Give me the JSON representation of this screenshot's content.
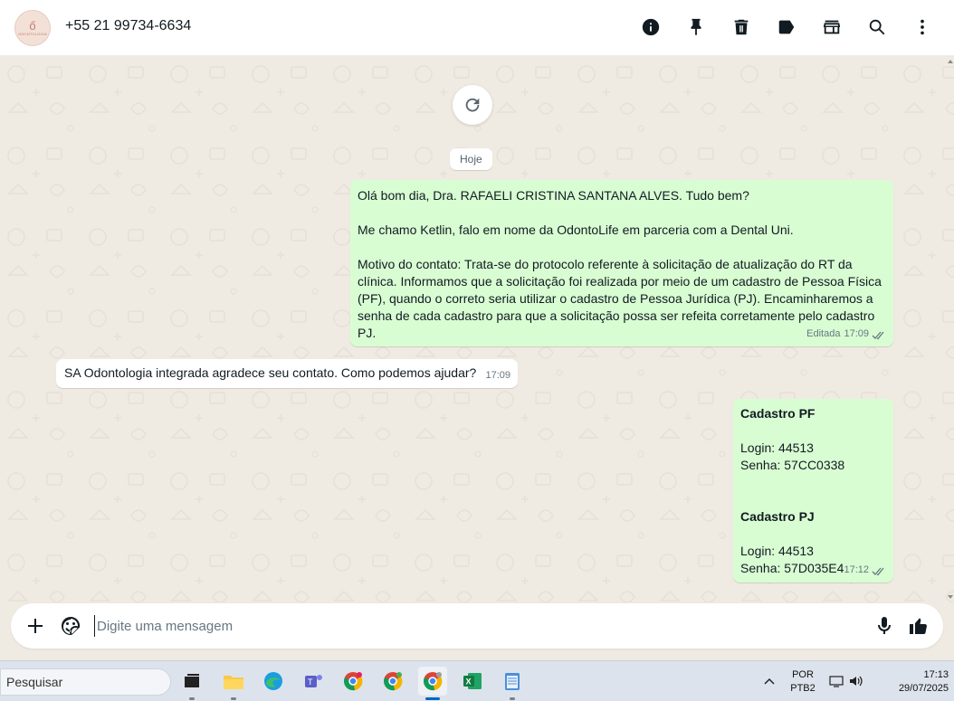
{
  "header": {
    "avatar_glyph": "ő",
    "avatar_text": "ODONTOLOGIA",
    "contact_name": "+55 21 99734-6634",
    "icons": [
      "info-icon",
      "pin-icon",
      "delete-icon",
      "label-icon",
      "store-icon",
      "search-icon",
      "more-vert-icon"
    ]
  },
  "chat": {
    "date_chip": "Hoje",
    "messages": [
      {
        "direction": "out",
        "lines": [
          "Olá bom dia, Dra. RAFAELI CRISTINA SANTANA ALVES. Tudo bem?",
          "",
          "Me chamo Ketlin, falo em nome da OdontoLife em parceria com a Dental Uni.",
          "",
          "Motivo do contato: Trata-se do protocolo referente à solicitação de atualização do RT da",
          "clínica. Informamos que a solicitação foi realizada por meio de um cadastro de Pessoa Física",
          "(PF), quando o correto seria utilizar o cadastro de Pessoa Jurídica (PJ). Encaminharemos a",
          "senha de cada cadastro para que a solicitação possa ser refeita corretamente pelo cadastro",
          "PJ."
        ],
        "edited_label": "Editada",
        "time": "17:09",
        "status": "read"
      },
      {
        "direction": "in",
        "text": "SA Odontologia integrada agradece seu contato. Como podemos ajudar?",
        "time": "17:09"
      },
      {
        "direction": "out",
        "pf_title": "Cadastro PF",
        "pf_login": "Login: 44513",
        "pf_senha": "Senha: 57CC0338",
        "pj_title": "Cadastro PJ",
        "pj_login": "Login: 44513",
        "pj_senha": "Senha: 57D035E4",
        "time": "17:12",
        "status": "read"
      }
    ]
  },
  "composer": {
    "placeholder": "Digite uma mensagem",
    "value": ""
  },
  "taskbar": {
    "search_placeholder": "Pesquisar",
    "apps": [
      "task-view",
      "file-explorer",
      "edge",
      "teams",
      "chrome-profile-1",
      "chrome-profile-2",
      "chrome-active",
      "excel",
      "notepad"
    ],
    "lang_line1": "POR",
    "lang_line2": "PTB2",
    "time": "17:13",
    "date": "29/07/2025"
  },
  "colors": {
    "outgoing_bubble": "#d9fdd3",
    "incoming_bubble": "#ffffff",
    "chat_background": "#efeae2",
    "meta_text": "#667781"
  }
}
